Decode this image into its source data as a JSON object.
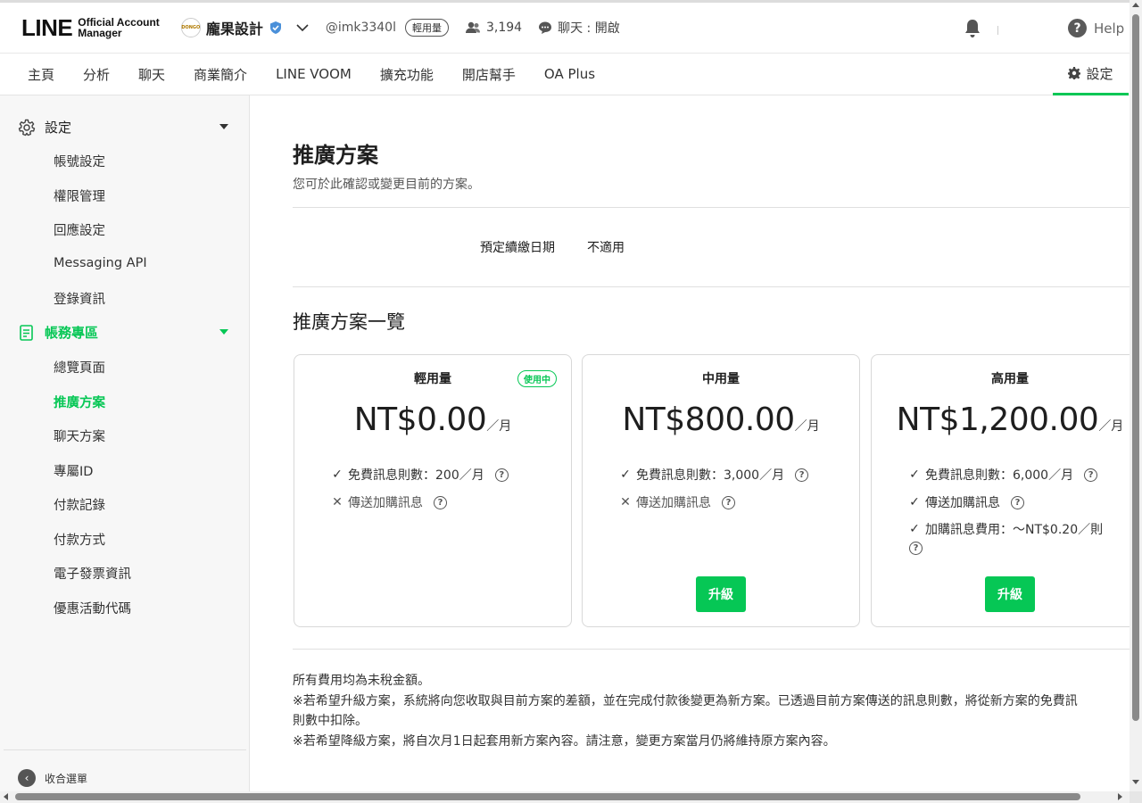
{
  "header": {
    "logo_main": "LINE",
    "logo_sub_1": "Official Account",
    "logo_sub_2": "Manager",
    "account_avatar_text": "DONGO",
    "account_name": "龐果設計",
    "account_id": "@imk3340l",
    "plan_badge": "輕用量",
    "friends_count": "3,194",
    "chat_status": "聊天 : 開啟",
    "help_label": "Help"
  },
  "nav": {
    "items": [
      "主頁",
      "分析",
      "聊天",
      "商業簡介",
      "LINE VOOM",
      "擴充功能",
      "開店幫手",
      "OA Plus"
    ],
    "settings_label": "設定"
  },
  "sidebar": {
    "settings_section": "設定",
    "settings_items": [
      "帳號設定",
      "權限管理",
      "回應設定",
      "Messaging API",
      "登錄資訊"
    ],
    "billing_section": "帳務專區",
    "billing_items": [
      "總覽頁面",
      "推廣方案",
      "聊天方案",
      "專屬ID",
      "付款記錄",
      "付款方式",
      "電子發票資訊",
      "優惠活動代碼"
    ],
    "active_item": "推廣方案",
    "collapse_label": "收合選單"
  },
  "main": {
    "title": "推廣方案",
    "subtitle": "您可於此確認或變更目前的方案。",
    "renewal_label": "預定續繳日期",
    "renewal_value": "不適用",
    "plan_list_title": "推廣方案一覽",
    "plans": [
      {
        "name": "輕用量",
        "current_badge": "使用中",
        "price": "NT$0.00",
        "unit": "／月",
        "features": [
          {
            "mark": "✓",
            "text": "免費訊息則數：200／月"
          },
          {
            "mark": "✕",
            "text": "傳送加購訊息"
          }
        ]
      },
      {
        "name": "中用量",
        "price": "NT$800.00",
        "unit": "／月",
        "features": [
          {
            "mark": "✓",
            "text": "免費訊息則數：3,000／月"
          },
          {
            "mark": "✕",
            "text": "傳送加購訊息"
          }
        ],
        "button": "升級"
      },
      {
        "name": "高用量",
        "price": "NT$1,200.00",
        "unit": "／月",
        "features": [
          {
            "mark": "✓",
            "text": "免費訊息則數：6,000／月"
          },
          {
            "mark": "✓",
            "text": "傳送加購訊息"
          },
          {
            "mark": "✓",
            "text": "加購訊息費用：～NT$0.20／則"
          }
        ],
        "button": "升級"
      }
    ],
    "notes": [
      "所有費用均為未稅金額。",
      "※若希望升級方案，系統將向您收取與目前方案的差額，並在完成付款後變更為新方案。已透過目前方案傳送的訊息則數，將從新方案的免費訊",
      "則數中扣除。",
      "※若希望降級方案，將自次月1日起套用新方案內容。請注意，變更方案當月仍將維持原方案內容。"
    ]
  },
  "colors": {
    "accent": "#06c755",
    "text": "#1e1e1e",
    "sidebar_bg": "#f7f7f7",
    "border": "#d8d8d8"
  }
}
